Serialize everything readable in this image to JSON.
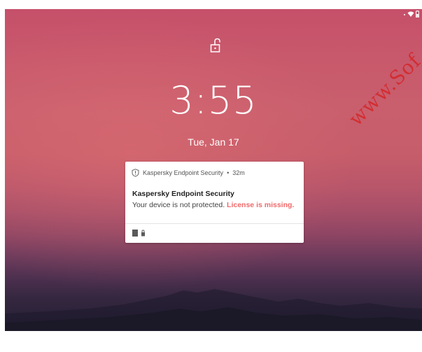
{
  "lock_screen": {
    "time": "3:55",
    "date": "Tue, Jan 17"
  },
  "status_bar": {
    "icons": [
      "signal-dot-icon",
      "wifi-icon",
      "battery-icon"
    ]
  },
  "notification": {
    "app_name": "Kaspersky Endpoint Security",
    "separator": "•",
    "elapsed": "32m",
    "title": "Kaspersky Endpoint Security",
    "message": "Your device is not protected.",
    "warning": "License is missing.",
    "app_icon": "shield-icon",
    "action_icons": [
      "app-square-icon",
      "small-lock-icon"
    ],
    "colors": {
      "warning": "#f06a6a",
      "card": "#ffffff"
    }
  },
  "watermark": {
    "text": "www.Sof"
  },
  "colors": {
    "sky_top": "#c6506a",
    "sky_bottom": "#241e33"
  }
}
